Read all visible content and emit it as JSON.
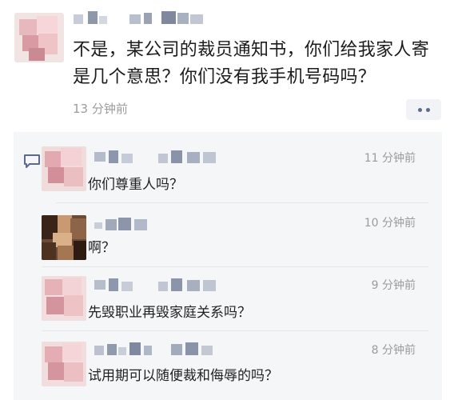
{
  "post": {
    "text": "不是，某公司的裁员通知书，你们给我家人寄是几个意思？你们没有我手机号码吗？",
    "time": "13 分钟前"
  },
  "comments": [
    {
      "text": "你们尊重人吗？",
      "time": "11 分钟前"
    },
    {
      "text": "啊？",
      "time": "10 分钟前"
    },
    {
      "text": "先毁职业再毁家庭关系吗？",
      "time": "9 分钟前"
    },
    {
      "text": "试用期可以随便裁和侮辱的吗？",
      "time": "8 分钟前"
    }
  ],
  "colors": {
    "time_gray": "#9b9b9b",
    "panel_bg": "#f5f6f8",
    "icon_blue": "#5b6b8c"
  },
  "icons": {
    "more": "more-dots-icon",
    "comment": "comment-bubble-icon"
  }
}
